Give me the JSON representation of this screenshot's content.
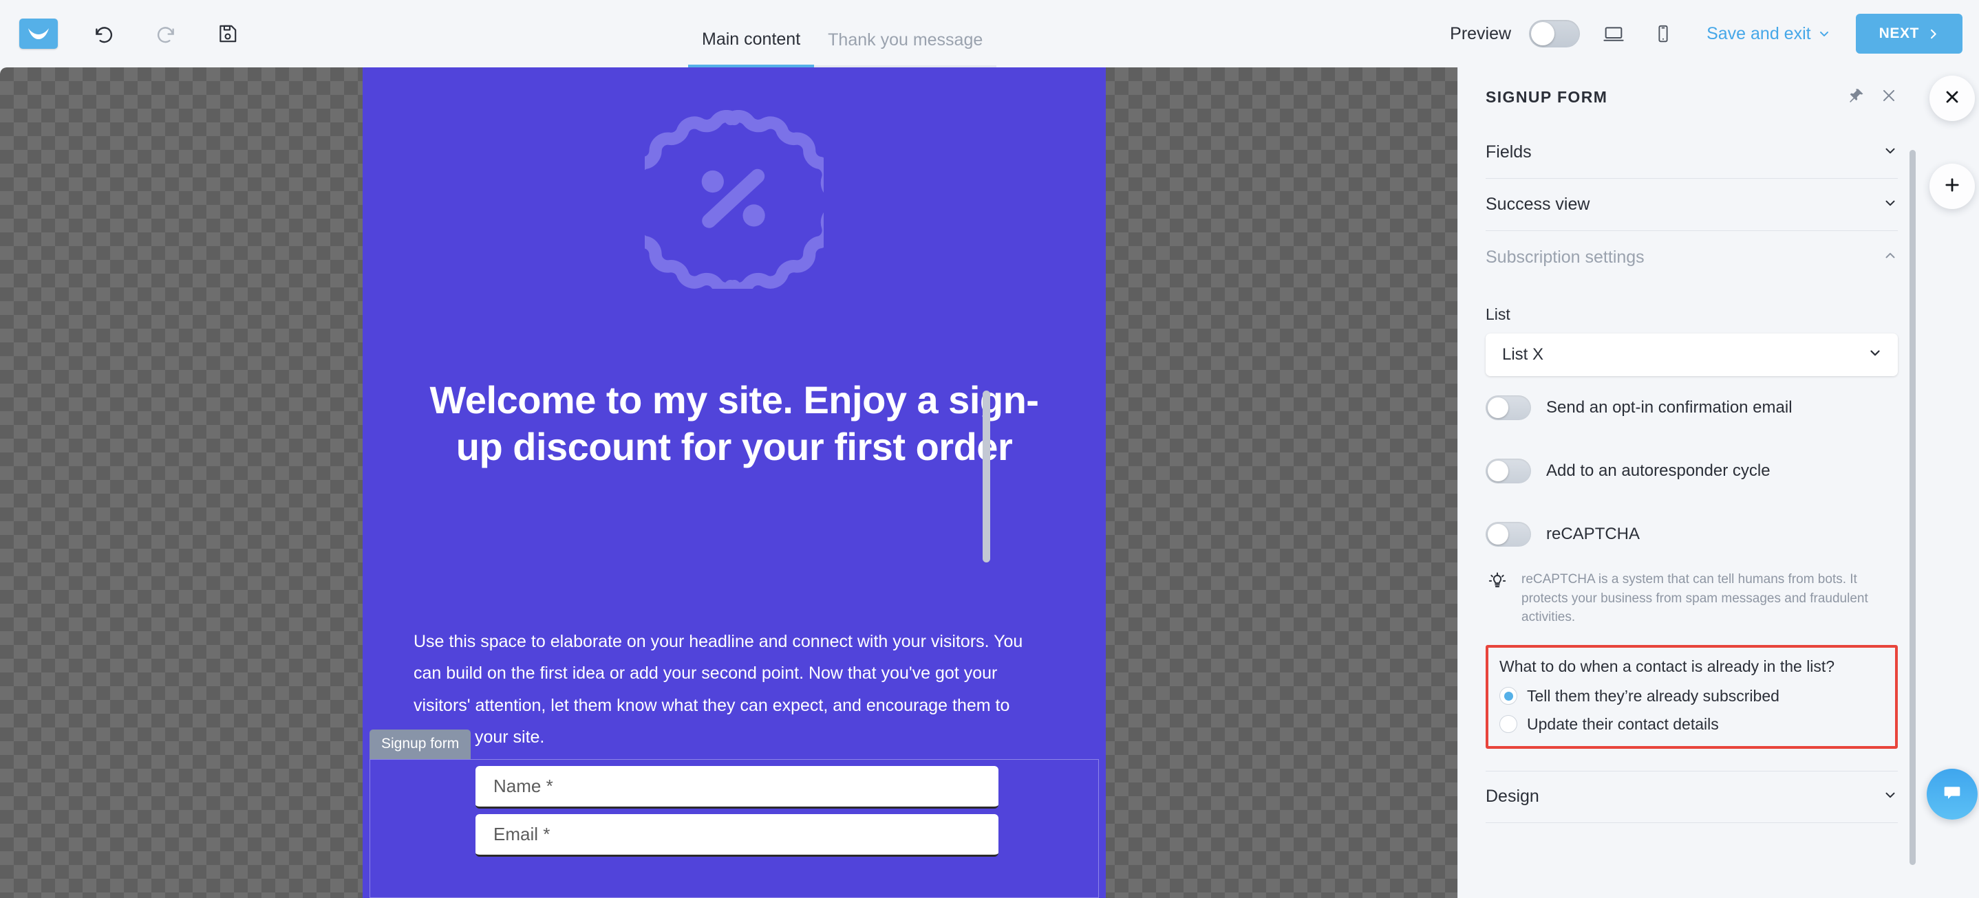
{
  "topbar": {
    "logo_icon": "mailerlite-envelope-logo",
    "undo_icon": "undo-arrow-icon",
    "redo_icon": "redo-arrow-icon",
    "save_icon": "floppy-disk-save-icon",
    "tabs": [
      {
        "label": "Main content",
        "active": true
      },
      {
        "label": "Thank you message",
        "active": false
      }
    ],
    "preview_label": "Preview",
    "preview_enabled": false,
    "desktop_icon": "desktop-monitor-icon",
    "mobile_icon": "mobile-phone-icon",
    "save_and_exit_label": "Save and exit",
    "save_and_exit_caret": "chevron-down-icon",
    "next_label": "NEXT",
    "next_caret": "chevron-right-icon",
    "accent_blue": "#55b0e8"
  },
  "canvas": {
    "form_bg_color": "#5144da",
    "badge_icon": "percent-discount-badge-icon",
    "headline": "Welcome to my site. Enjoy a sign-up discount for your first order",
    "subcopy": "Use this space to elaborate on your headline and connect with your visitors. You can build on the first idea or add your second point. Now that you've got your visitors' attention, let them know what they can expect, and encourage them to explore your site.",
    "block_tag": "Signup form",
    "fields": [
      {
        "placeholder": "Name *"
      },
      {
        "placeholder": "Email *"
      }
    ]
  },
  "panel": {
    "title": "SIGNUP FORM",
    "pin_icon": "pin-icon",
    "close_icon": "close-x-icon",
    "sections": [
      {
        "label": "Fields",
        "open": false,
        "caret": "chevron-down-icon"
      },
      {
        "label": "Success view",
        "open": false,
        "caret": "chevron-down-icon"
      },
      {
        "label": "Subscription settings",
        "open": true,
        "caret": "chevron-up-icon"
      }
    ],
    "list_field_label": "List",
    "list_value": "List X",
    "list_caret": "chevron-down-icon",
    "toggles": [
      {
        "label": "Send an opt-in confirmation email",
        "on": false
      },
      {
        "label": "Add to an autoresponder cycle",
        "on": false
      },
      {
        "label": "reCAPTCHA",
        "on": false
      }
    ],
    "hint_icon": "lightbulb-icon",
    "hint_text": "reCAPTCHA is a system that can tell humans from bots. It protects your business from spam messages and fraudulent activities.",
    "duplicate": {
      "highlight_color": "#e8453c",
      "question": "What to do when a contact is already in the list?",
      "options": [
        {
          "label": "Tell them they’re already subscribed",
          "selected": true
        },
        {
          "label": "Update their contact details",
          "selected": false
        }
      ]
    },
    "design_label": "Design",
    "design_caret": "chevron-down-icon"
  },
  "fabs": {
    "close_icon": "close-x-icon",
    "add_icon": "plus-add-icon",
    "chat_icon": "chat-bubble-icon"
  }
}
